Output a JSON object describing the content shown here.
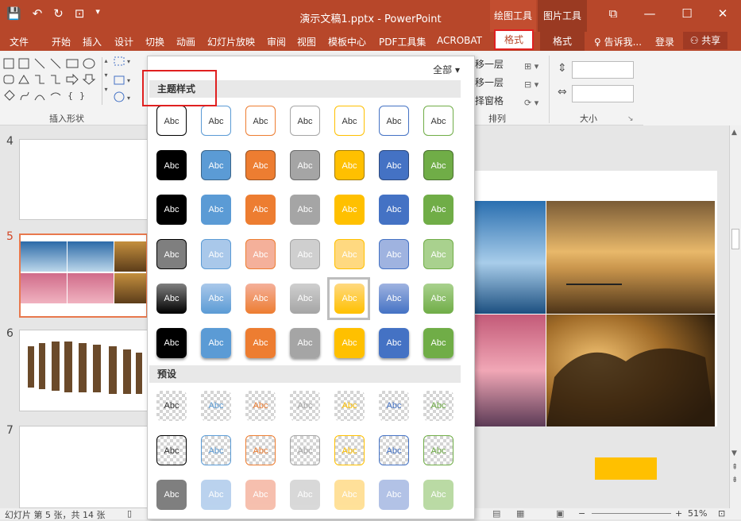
{
  "titlebar": {
    "doc_title": "演示文稿1.pptx - PowerPoint",
    "ctx_drawing_tools": "绘图工具",
    "ctx_picture_tools": "图片工具",
    "win_restore": "⧉",
    "win_min": "—",
    "win_max": "☐",
    "win_close": "✕"
  },
  "tabs": [
    "文件",
    "开始",
    "插入",
    "设计",
    "切换",
    "动画",
    "幻灯片放映",
    "审阅",
    "视图",
    "模板中心",
    "PDF工具集",
    "ACROBAT"
  ],
  "tab_format_active": "格式",
  "tab_format_picture": "格式",
  "tell_me": "♀ 告诉我...",
  "login": "登录",
  "share": "⚇ 共享",
  "ribbon": {
    "insert_shapes_label": "插入形状",
    "arrange_label": "排列",
    "size_label": "大小",
    "bring_forward": "移一层",
    "send_backward": "移一层",
    "selection_pane": "择窗格"
  },
  "slides": {
    "n4": "4",
    "n5": "5",
    "n6": "6",
    "n7": "7"
  },
  "dropdown": {
    "all_label": "全部 ▾",
    "theme_styles": "主题样式",
    "presets": "预设",
    "swatch_text": "Abc"
  },
  "status": {
    "slide_info": "幻灯片 第 5 张，共 14 张",
    "zoom": "51%"
  },
  "colors": {
    "accent": "#b7472a",
    "black": "#000000",
    "blue": "#5b9bd5",
    "orange": "#ed7d31",
    "gray": "#a5a5a5",
    "gold": "#ffc000",
    "darkblue": "#4472c4",
    "green": "#70ad47"
  }
}
